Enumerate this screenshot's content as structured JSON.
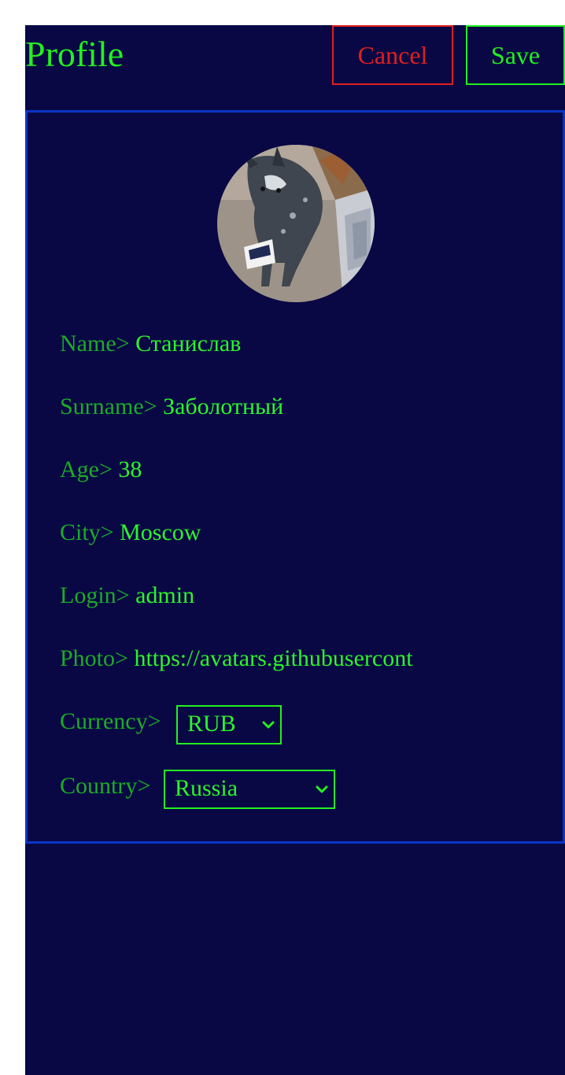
{
  "header": {
    "title": "Profile",
    "cancel_label": "Cancel",
    "save_label": "Save"
  },
  "profile": {
    "fields": [
      {
        "label": "Name>",
        "value": "Станислав"
      },
      {
        "label": "Surname>",
        "value": "Заболотный"
      },
      {
        "label": "Age>",
        "value": "38"
      },
      {
        "label": "City>",
        "value": "Moscow"
      },
      {
        "label": "Login>",
        "value": "admin"
      },
      {
        "label": "Photo>",
        "value": "https://avatars.githubusercont"
      }
    ],
    "currency": {
      "label": "Currency>",
      "selected": "RUB"
    },
    "country": {
      "label": "Country>",
      "selected": "Russia"
    }
  },
  "colors": {
    "background": "#090845",
    "accent_green": "#23f01f",
    "label_green": "#1cab26",
    "cancel_red": "#e01f1f",
    "card_border_blue": "#0b34c4"
  },
  "icons": {
    "avatar": "dog-photo-avatar",
    "select_arrow": "chevron-down-icon"
  }
}
